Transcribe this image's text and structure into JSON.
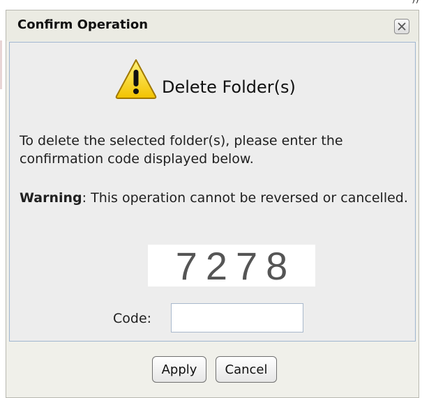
{
  "dialog": {
    "title": "Confirm Operation",
    "heading": "Delete Folder(s)",
    "instruction": "To delete the selected folder(s), please enter the confirmation code displayed below.",
    "warning_label": "Warning",
    "warning_text": ": This operation cannot be reversed or cancelled.",
    "captcha_code": "7278",
    "code_label": "Code:",
    "code_value": "",
    "apply_label": "Apply",
    "cancel_label": "Cancel"
  },
  "icons": {
    "close": "close-icon",
    "warning": "warning-icon"
  },
  "colors": {
    "warning_icon_fill": "#f5d000",
    "panel_border": "#9fb5cf",
    "dialog_bg": "#f0f0ea"
  }
}
